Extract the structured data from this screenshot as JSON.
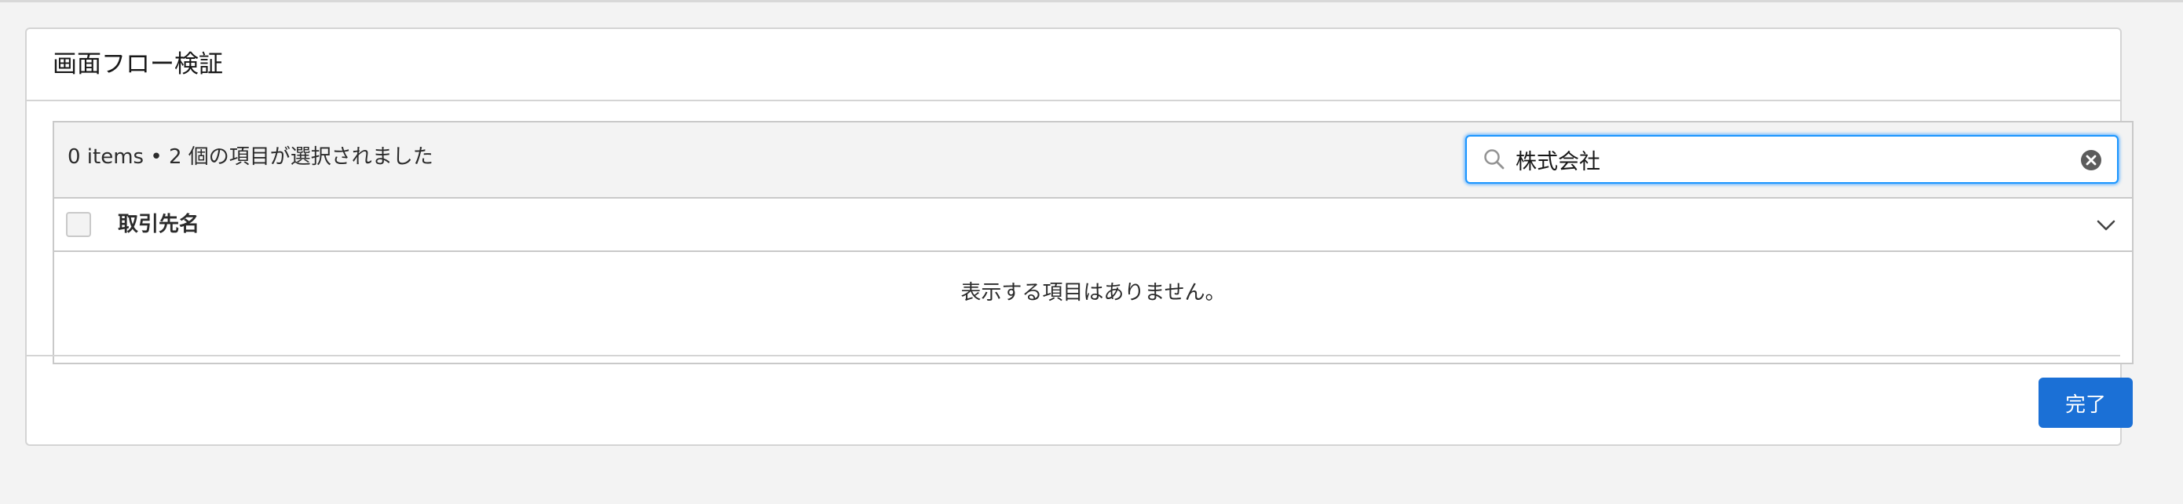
{
  "dialog": {
    "title": "画面フロー検証"
  },
  "table": {
    "item_count": "0 items • 2 個の項目が選択されました",
    "search": {
      "value": "株式会社",
      "placeholder": ""
    },
    "columns": [
      {
        "label": "取引先名"
      }
    ],
    "empty_message": "表示する項目はありません。"
  },
  "footer": {
    "done_label": "完了"
  },
  "icons": {
    "search": "search-icon",
    "clear": "clear-icon",
    "column_menu": "chevron-down-icon"
  },
  "colors": {
    "accent": "#1b96ff",
    "primary_button": "#1b70d6",
    "background": "#f3f3f3"
  }
}
